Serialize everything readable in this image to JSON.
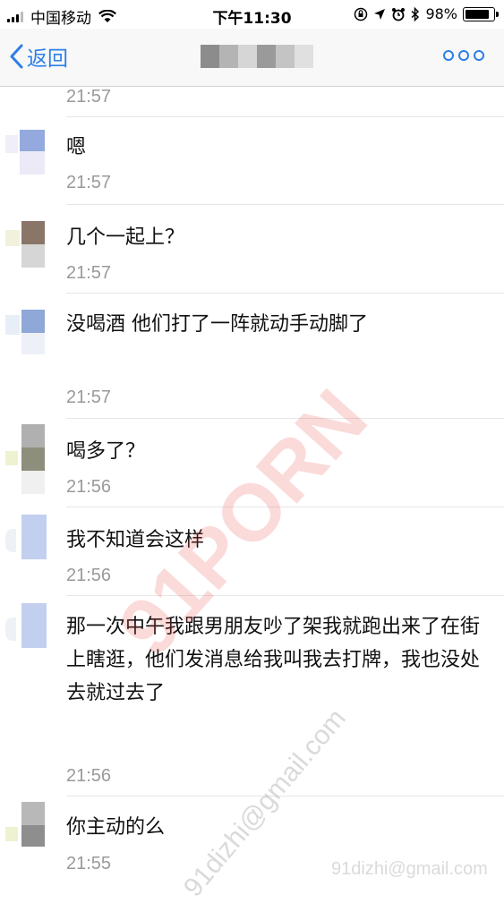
{
  "status_bar": {
    "carrier": "中国移动",
    "time": "下午11:30",
    "battery": "98%",
    "battery_level": 0.98
  },
  "nav": {
    "back_label": "返回"
  },
  "messages": [
    {
      "text": "",
      "time": "21:57"
    },
    {
      "text": "嗯",
      "time": "21:57"
    },
    {
      "text": "几个一起上？",
      "time": "21:57"
    },
    {
      "text": "没喝酒 他们打了一阵就动手动脚了",
      "time": "21:57"
    },
    {
      "text": "喝多了？",
      "time": "21:56"
    },
    {
      "text": "我不知道会这样",
      "time": "21:56"
    },
    {
      "text": "那一次中午我跟男朋友吵了架我就跑出来了在街上瞎逛，他们发消息给我叫我去打牌，我也没处去就过去了",
      "time": "21:56"
    },
    {
      "text": "你主动的么",
      "time": "21:55"
    }
  ],
  "watermarks": {
    "large": "91PORN",
    "email_diagonal": "91dizhi@gmail.com",
    "email_bottom": "91dizhi@gmail.com"
  },
  "colors": {
    "accent": "#2c7fe8",
    "time_text": "#9a9a9a"
  }
}
